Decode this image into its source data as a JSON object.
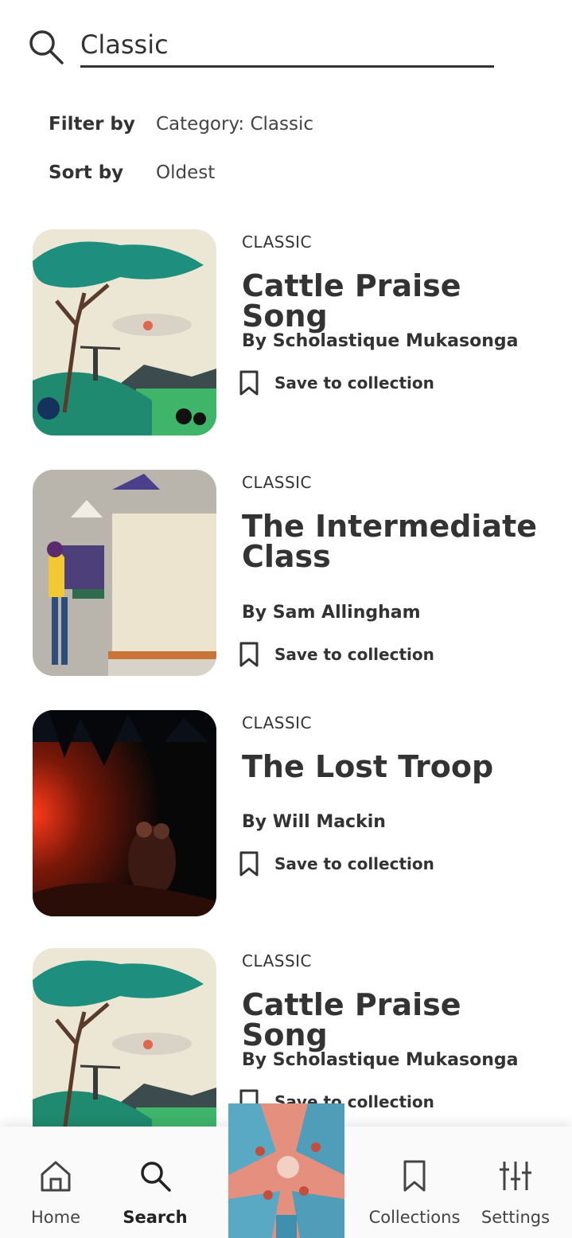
{
  "search": {
    "value": "Classic",
    "icon": "search-icon"
  },
  "filters": {
    "filter_label": "Filter by",
    "filter_value": "Category: Classic",
    "sort_label": "Sort by",
    "sort_value": "Oldest"
  },
  "results": [
    {
      "category": "CLASSIC",
      "title": "Cattle Praise Song",
      "author": "By Scholastique Mukasonga",
      "save_label": "Save to collection"
    },
    {
      "category": "CLASSIC",
      "title": "The Intermediate Class",
      "author": "By Sam Allingham",
      "save_label": "Save to collection"
    },
    {
      "category": "CLASSIC",
      "title": "The Lost Troop",
      "author": "By Will Mackin",
      "save_label": "Save to collection"
    },
    {
      "category": "CLASSIC",
      "title": "Cattle Praise Song",
      "author": "By Scholastique Mukasonga",
      "save_label": "Save to collection"
    }
  ],
  "nav": {
    "active": "Search",
    "items": [
      {
        "label": "Home",
        "icon": "home-icon"
      },
      {
        "label": "Search",
        "icon": "search-icon"
      },
      {
        "label": "Collections",
        "icon": "bookmark-icon"
      },
      {
        "label": "Settings",
        "icon": "sliders-icon"
      }
    ]
  },
  "colors": {
    "text": "#333333",
    "nav_bg": "#fafafa"
  }
}
